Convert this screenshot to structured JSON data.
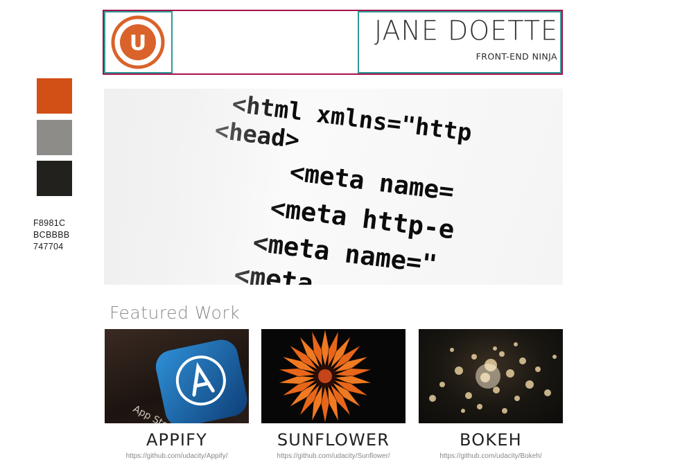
{
  "palette": {
    "swatches": [
      "#d24f16",
      "#8e8c89",
      "#23211e"
    ],
    "codes": [
      "F8981C",
      "BCBBBB",
      "747704"
    ]
  },
  "header": {
    "logo_letter": "U",
    "logo_color": "#d9632a",
    "name": "JANE DOETTE",
    "tagline": "FRONT-END NINJA"
  },
  "hero": {
    "lines": [
      "<html xmlns=\"http",
      "<head>",
      "<meta name=",
      "<meta http-e",
      "<meta name=\"",
      "<meta"
    ]
  },
  "featured": {
    "title": "Featured Work",
    "projects": [
      {
        "title": "APPIFY",
        "link": "https://github.com/udacity/Appify/",
        "thumb_text": "App Store"
      },
      {
        "title": "SUNFLOWER",
        "link": "https://github.com/udacity/Sunflower/"
      },
      {
        "title": "BOKEH",
        "link": "https://github.com/udacity/Bokeh/"
      }
    ]
  },
  "colors": {
    "header_border": "#a4124b",
    "box_border": "#2d9a98",
    "accent": "#d9632a"
  }
}
